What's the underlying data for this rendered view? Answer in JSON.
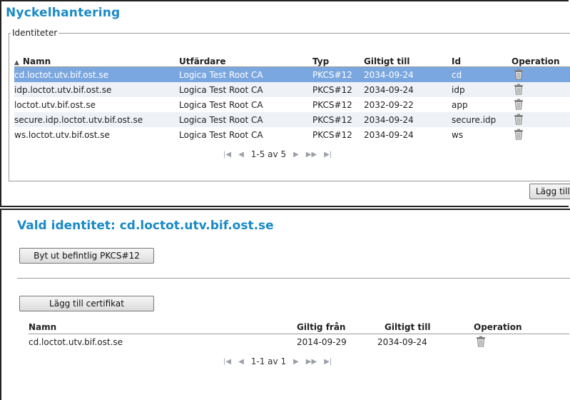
{
  "page": {
    "title": "Nyckelhantering"
  },
  "identities": {
    "legend": "Identiteter",
    "columns": [
      "Namn",
      "Utfärdare",
      "Typ",
      "Giltigt till",
      "Id",
      "Operation"
    ],
    "rows": [
      {
        "name": "cd.loctot.utv.bif.ost.se",
        "issuer": "Logica Test Root CA",
        "type": "PKCS#12",
        "valid_to": "2034-09-24",
        "id": "cd",
        "selected": true
      },
      {
        "name": "idp.loctot.utv.bif.ost.se",
        "issuer": "Logica Test Root CA",
        "type": "PKCS#12",
        "valid_to": "2034-09-24",
        "id": "idp",
        "selected": false
      },
      {
        "name": "loctot.utv.bif.ost.se",
        "issuer": "Logica Test Root CA",
        "type": "PKCS#12",
        "valid_to": "2032-09-22",
        "id": "app",
        "selected": false
      },
      {
        "name": "secure.idp.loctot.utv.bif.ost.se",
        "issuer": "Logica Test Root CA",
        "type": "PKCS#12",
        "valid_to": "2034-09-24",
        "id": "secure.idp",
        "selected": false
      },
      {
        "name": "ws.loctot.utv.bif.ost.se",
        "issuer": "Logica Test Root CA",
        "type": "PKCS#12",
        "valid_to": "2034-09-24",
        "id": "ws",
        "selected": false
      }
    ],
    "pager_text": "1-5 av 5",
    "add_button": "Lägg till"
  },
  "selected_identity": {
    "title": "Vald identitet: cd.loctot.utv.bif.ost.se",
    "replace_button": "Byt ut befintlig PKCS#12",
    "add_cert_button": "Lägg till certifikat",
    "columns": [
      "Namn",
      "Giltig från",
      "Giltigt till",
      "Operation"
    ],
    "rows": [
      {
        "name": "cd.loctot.utv.bif.ost.se",
        "valid_from": "2014-09-29",
        "valid_to": "2034-09-24"
      }
    ],
    "pager_text": "1-1 av 1"
  },
  "icons": {
    "sort": "sort-ascending-icon",
    "delete": "trash-icon",
    "pager": [
      "first-page-icon",
      "prev-page-icon",
      "next-page-icon",
      "last-page-icon",
      "last-page-icon"
    ]
  },
  "colors": {
    "title": "#1a8ac6",
    "selected_row": "#7ba7e0",
    "alt_row": "#eef2f7"
  }
}
